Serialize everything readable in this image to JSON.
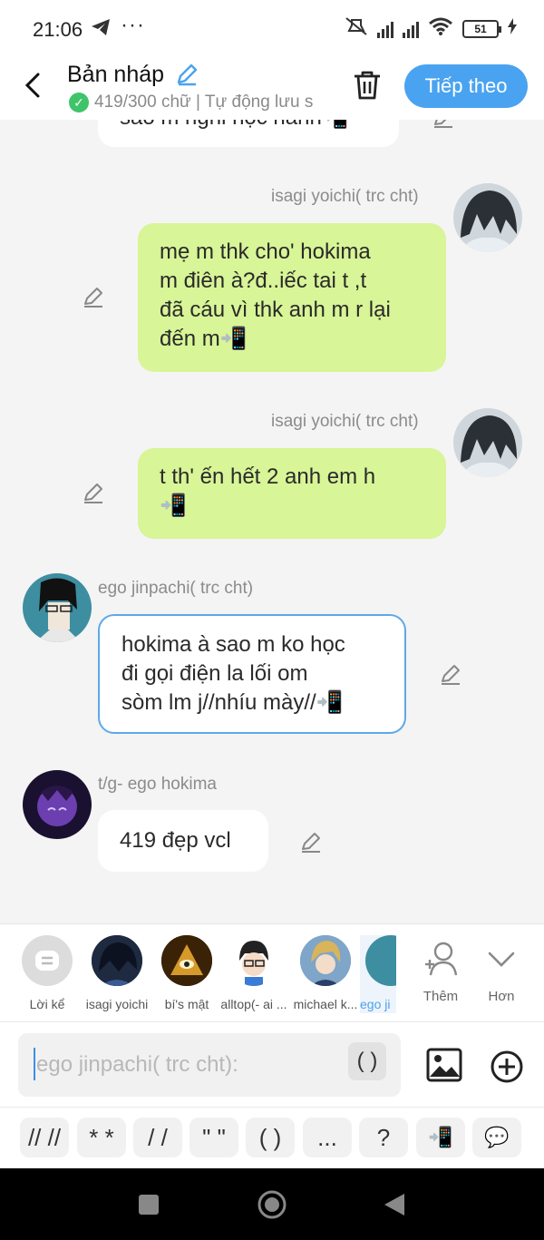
{
  "status": {
    "time": "21:06",
    "battery": "51"
  },
  "header": {
    "title": "Bản nháp",
    "subtitle": "419/300 chữ | Tự động lưu s",
    "next_label": "Tiếp theo"
  },
  "messages": [
    {
      "text": "sao m nghỉ học hành📲"
    },
    {
      "sender": "isagi yoichi( trc cht)",
      "lines": [
        "mẹ m thk cho' hokima",
        "m điên à?đ..iếc tai t ,t",
        "đã cáu vì thk anh m r lại",
        "đến m📲"
      ]
    },
    {
      "sender": "isagi yoichi( trc cht)",
      "lines": [
        "t th' ến hết 2 anh em h",
        "📲"
      ]
    },
    {
      "sender": "ego jinpachi( trc cht)",
      "lines": [
        "hokima à sao m ko học",
        "đi gọi điện la lối om",
        "sòm lm j//nhíu mày//📲"
      ]
    },
    {
      "sender": "t/g- ego hokima",
      "lines": [
        "419 đẹp vcl"
      ]
    }
  ],
  "characters": [
    {
      "label": "Lời kể"
    },
    {
      "label": "isagi yoichi"
    },
    {
      "label": "bí's mật"
    },
    {
      "label": "alltop(- ai ..."
    },
    {
      "label": "michael k..."
    },
    {
      "label": "ego ji"
    }
  ],
  "tools": {
    "add_label": "Thêm",
    "more_label": "Hơn"
  },
  "input": {
    "placeholder": "ego jinpachi( trc cht):",
    "paren": "( )"
  },
  "chips": [
    "// //",
    "* *",
    "/ /",
    "\" \"",
    "( )",
    "...",
    "?",
    "📲",
    "💬"
  ]
}
